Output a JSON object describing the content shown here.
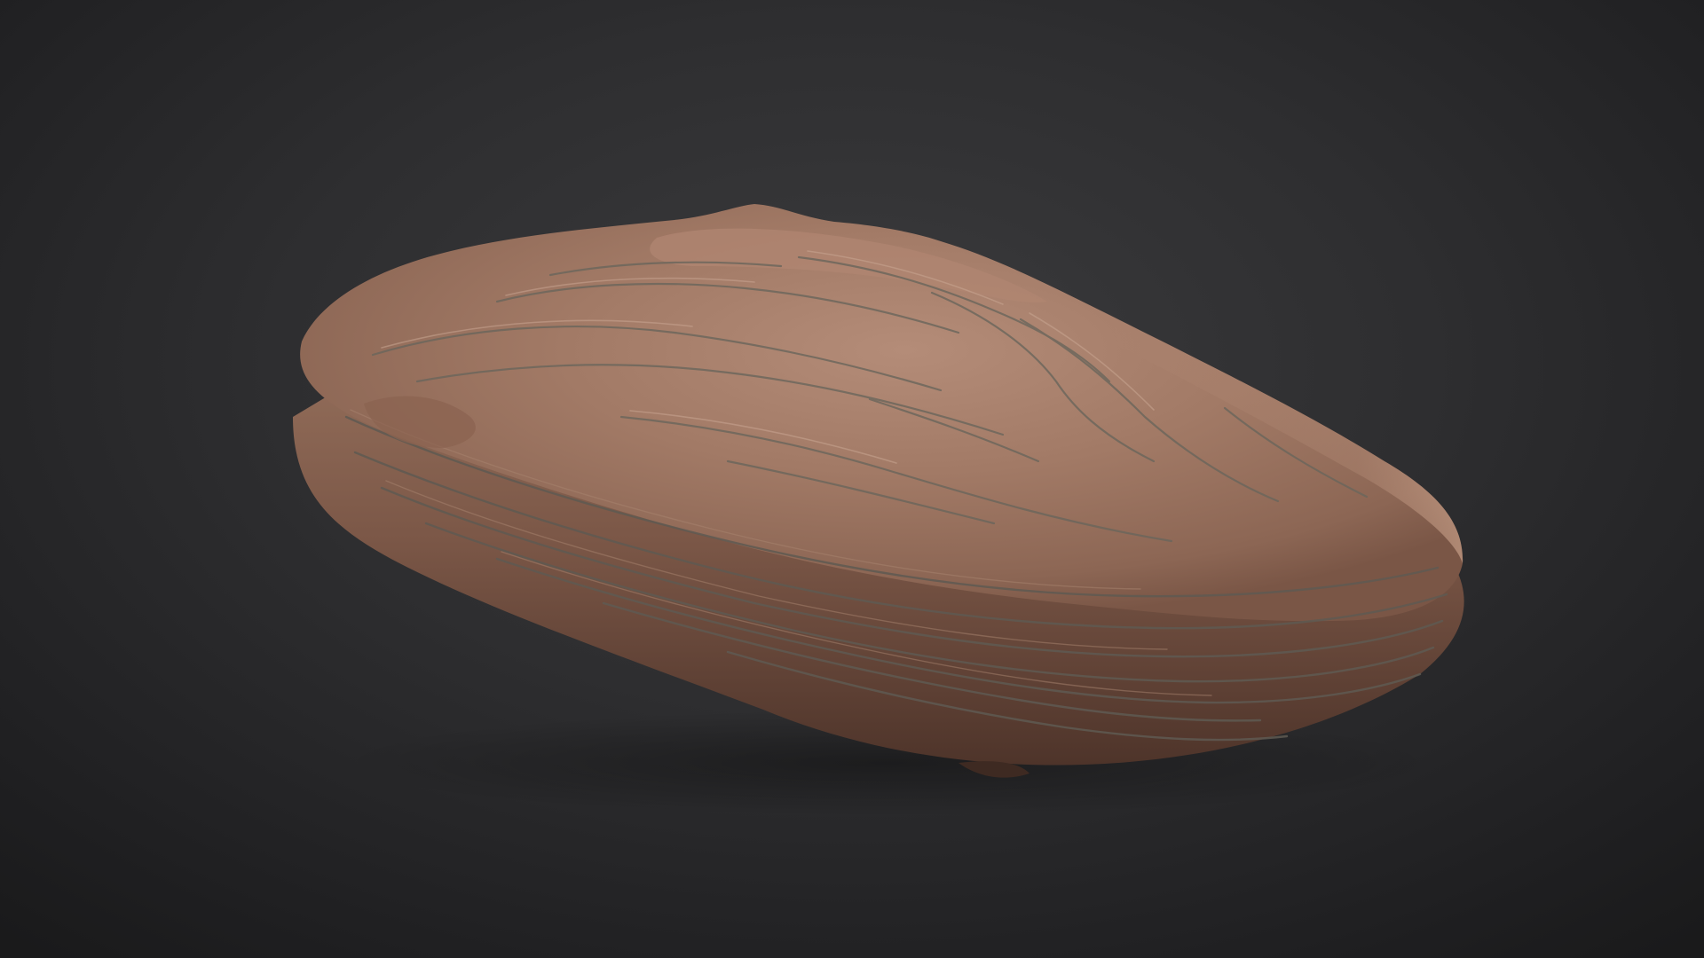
{
  "scene": {
    "background_color": "#2e2e30",
    "background_edge_color": "#1a1a1b",
    "subject": "sandstone-rock",
    "colors": {
      "rock_top": "#a67e6a",
      "rock_top_light": "#c29b85",
      "rock_side": "#7e5a48",
      "rock_side_dark": "#5a3c2f",
      "crack": "#6e6e62",
      "highlight": "#d7b5a0"
    }
  }
}
